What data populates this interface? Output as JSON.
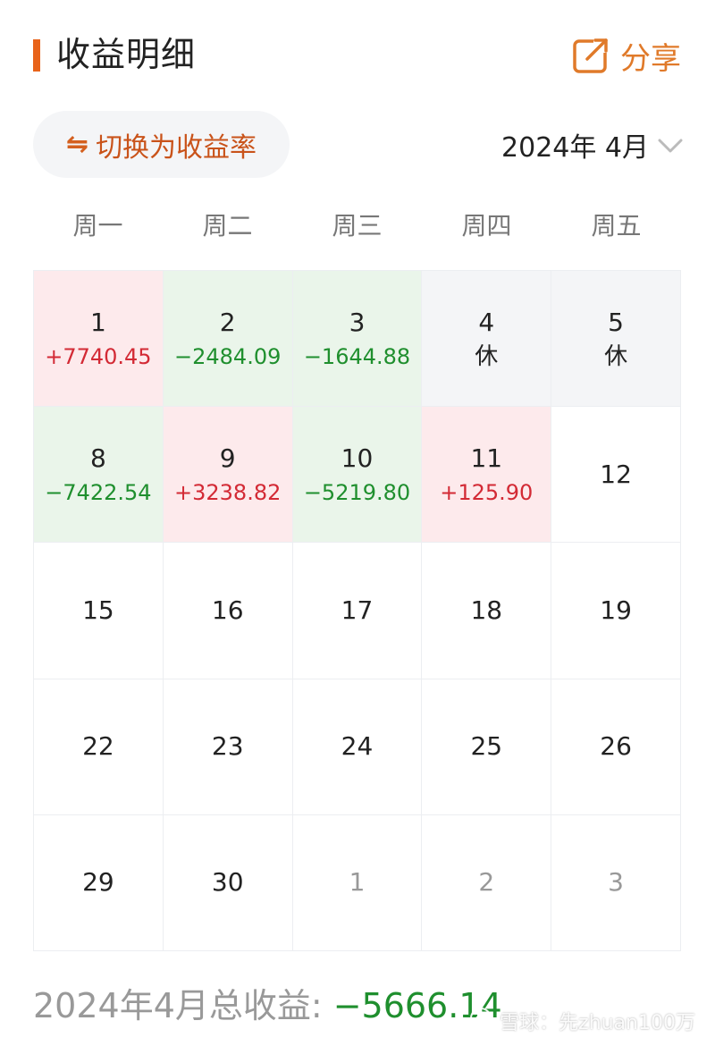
{
  "header": {
    "title": "收益明细",
    "share_label": "分享",
    "accent_color": "#e8631a"
  },
  "toggle": {
    "icon": "⇋",
    "label": "切换为收益率"
  },
  "month_picker": {
    "label": "2024年 4月"
  },
  "weekdays": [
    "周一",
    "周二",
    "周三",
    "周四",
    "周五"
  ],
  "calendar": {
    "cells": [
      {
        "day": "1",
        "value": "+7740.45",
        "type": "gain"
      },
      {
        "day": "2",
        "value": "−2484.09",
        "type": "loss"
      },
      {
        "day": "3",
        "value": "−1644.88",
        "type": "loss"
      },
      {
        "day": "4",
        "value": "休",
        "type": "rest"
      },
      {
        "day": "5",
        "value": "休",
        "type": "rest"
      },
      {
        "day": "8",
        "value": "−7422.54",
        "type": "loss"
      },
      {
        "day": "9",
        "value": "+3238.82",
        "type": "gain"
      },
      {
        "day": "10",
        "value": "−5219.80",
        "type": "loss"
      },
      {
        "day": "11",
        "value": "+125.90",
        "type": "gain"
      },
      {
        "day": "12",
        "value": "",
        "type": "none"
      },
      {
        "day": "15",
        "value": "",
        "type": "none"
      },
      {
        "day": "16",
        "value": "",
        "type": "none"
      },
      {
        "day": "17",
        "value": "",
        "type": "none"
      },
      {
        "day": "18",
        "value": "",
        "type": "none"
      },
      {
        "day": "19",
        "value": "",
        "type": "none"
      },
      {
        "day": "22",
        "value": "",
        "type": "none"
      },
      {
        "day": "23",
        "value": "",
        "type": "none"
      },
      {
        "day": "24",
        "value": "",
        "type": "none"
      },
      {
        "day": "25",
        "value": "",
        "type": "none"
      },
      {
        "day": "26",
        "value": "",
        "type": "none"
      },
      {
        "day": "29",
        "value": "",
        "type": "none"
      },
      {
        "day": "30",
        "value": "",
        "type": "none"
      },
      {
        "day": "1",
        "value": "",
        "type": "other"
      },
      {
        "day": "2",
        "value": "",
        "type": "other"
      },
      {
        "day": "3",
        "value": "",
        "type": "other"
      }
    ]
  },
  "total": {
    "label": "2024年4月总收益:",
    "amount": "−5666.14"
  },
  "watermark": {
    "text": "雪球：先zhuan100万"
  },
  "colors": {
    "gain_text": "#d32a35",
    "loss_text": "#1f8f2e",
    "gain_bg": "#fdeaec",
    "loss_bg": "#eaf5ea",
    "rest_bg": "#f4f5f7"
  }
}
